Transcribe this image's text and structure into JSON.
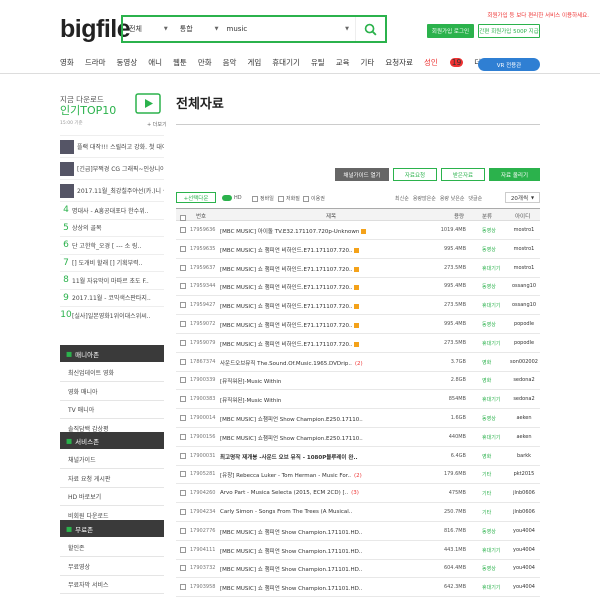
{
  "logo": {
    "text": "bigfile"
  },
  "search": {
    "category": "전체",
    "type": "통합",
    "query": "music"
  },
  "top_right": {
    "note": "회원가입 등 보다 편리한 서비스 이용하세요.",
    "login_label": "회원가입 로그인",
    "promo_label": "간편 회원가입 500P 지급"
  },
  "menu": [
    {
      "label": "영화",
      "hot": false
    },
    {
      "label": "드라마",
      "hot": false
    },
    {
      "label": "동영상",
      "hot": false
    },
    {
      "label": "애니",
      "hot": false
    },
    {
      "label": "웹툰",
      "hot": false
    },
    {
      "label": "만화",
      "hot": false
    },
    {
      "label": "음악",
      "hot": false
    },
    {
      "label": "게임",
      "hot": false
    },
    {
      "label": "휴대기기",
      "hot": false
    },
    {
      "label": "유틸",
      "hot": false
    },
    {
      "label": "교육",
      "hot": false
    },
    {
      "label": "기타",
      "hot": false
    },
    {
      "label": "요청자료",
      "hot": false
    },
    {
      "label": "성인",
      "hot": true
    },
    {
      "label": "더보기",
      "hot": false
    }
  ],
  "menu_badge": "19",
  "vr_label": "VR 전용관",
  "top10": {
    "heading": "지금 다운로드",
    "title": "인기TOP10",
    "sub": "15:00 기준",
    "more": "+ 더보기"
  },
  "ranking": [
    {
      "n": "1",
      "text": "플랙 대작!!! 스릴러고 강화. 첫 대이런~특정 자.."
    },
    {
      "n": "2",
      "text": "[긴급]부쩍경 CG 그래픽~인상니아 계곡의 불 앞 .."
    },
    {
      "n": "3",
      "text": "2017.11월_최강칠주야선(카.)니 셀 D 8트-완벽한글."
    },
    {
      "n": "4",
      "text": "명대사 - A흥공대포다 한수위.."
    },
    {
      "n": "5",
      "text": "상상의 골목"
    },
    {
      "n": "6",
      "text": "단 고한학_오경 [ --- 소 링.."
    },
    {
      "n": "7",
      "text": "[] 도개비 할래 [] 기획부력.."
    },
    {
      "n": "8",
      "text": "11월 자유막이 마따르 초도 F.."
    },
    {
      "n": "9",
      "text": "2017.11월 - 코믹색스판타지.."
    },
    {
      "n": "10",
      "text": "[실사]일본영화1위이대스위씨.."
    }
  ],
  "sections": [
    {
      "title": "매니아존",
      "items": [
        "최신업데이트 영화",
        "영화 매니아",
        "TV 매니아",
        "솔직담백 감상평"
      ]
    },
    {
      "title": "서비스존",
      "items": [
        "채널가이드",
        "자료 요청 게시판",
        "HD 바로보기",
        "비회원 다운로드"
      ]
    },
    {
      "title": "무료존",
      "items": [
        "할인존",
        "무료영상",
        "무료자막 서비스",
        "무료준비"
      ]
    }
  ],
  "main": {
    "title": "전체자료",
    "btn_guide": "채널가이드 열기",
    "btn_request": "자료요청",
    "btn_down": "받은자료",
    "btn_upload": "자료 올리기",
    "filter_label": "+선택다운",
    "opt_hd": "HD",
    "opt_hi": "정바일",
    "opt_low": "저화질",
    "opt_img": "이용권",
    "sorts": [
      "최신순",
      "용량많은순",
      "용량 낮은순",
      "댓글순"
    ],
    "per_page": "20개씩",
    "headers": {
      "no": "번호",
      "title": "제목",
      "size": "용량",
      "cat": "분류",
      "uploader": "아이디"
    }
  },
  "rows": [
    {
      "id": "17959636",
      "title": "[MBC MUSIC] 아이돌 TV.E32.171107.720p-Unknown",
      "bold": false,
      "badge": "",
      "icon": true,
      "size": "1019.4MB",
      "cat": "동영상",
      "up": "mostro1"
    },
    {
      "id": "17959635",
      "title": "[MBC MUSIC] 쇼 챔피언 비하인드.E71.171107.720..",
      "bold": false,
      "badge": "",
      "icon": true,
      "size": "995.4MB",
      "cat": "동영상",
      "up": "mostro1"
    },
    {
      "id": "17959637",
      "title": "[MBC MUSIC] 쇼 챔피언 비하인드.E71.171107.720..",
      "bold": false,
      "badge": "",
      "icon": true,
      "size": "273.5MB",
      "cat": "휴대기기",
      "up": "mostro1"
    },
    {
      "id": "17959344",
      "title": "[MBC MUSIC] 쇼 챔피언 비하인드.E71.171107.720..",
      "bold": false,
      "badge": "",
      "icon": true,
      "size": "995.4MB",
      "cat": "동영상",
      "up": "ossang10"
    },
    {
      "id": "17959427",
      "title": "[MBC MUSIC] 쇼 챔피언 비하인드.E71.171107.720..",
      "bold": false,
      "badge": "",
      "icon": true,
      "size": "273.5MB",
      "cat": "휴대기기",
      "up": "ossang10"
    },
    {
      "id": "17959072",
      "title": "[MBC MUSIC] 쇼 챔피언 비하인드.E71.171107.720..",
      "bold": false,
      "badge": "",
      "icon": true,
      "size": "995.4MB",
      "cat": "동영상",
      "up": "popodle"
    },
    {
      "id": "17959079",
      "title": "[MBC MUSIC] 쇼 챔피언 비하인드.E71.171107.720..",
      "bold": false,
      "badge": "",
      "icon": true,
      "size": "273.5MB",
      "cat": "휴대기기",
      "up": "popodle"
    },
    {
      "id": "17867374",
      "title": "사운드오브뮤직 The.Sound.Of.Music.1965.DVDrip..",
      "bold": false,
      "badge": "(2)",
      "icon": false,
      "size": "3.7GB",
      "cat": "영화",
      "up": "son002002"
    },
    {
      "id": "17900339",
      "title": "[뮤직워된]-Music Within",
      "bold": false,
      "badge": "",
      "icon": false,
      "size": "2.8GB",
      "cat": "영화",
      "up": "sedona2"
    },
    {
      "id": "17900383",
      "title": "[뮤직워된]-Music Within",
      "bold": false,
      "badge": "",
      "icon": false,
      "size": "854MB",
      "cat": "휴대기기",
      "up": "sedona2"
    },
    {
      "id": "17900014",
      "title": "[MBC MUSIC] 쇼챔피언 Show Champion.E250.17110..",
      "bold": false,
      "badge": "",
      "icon": false,
      "size": "1.6GB",
      "cat": "동영상",
      "up": "aeken"
    },
    {
      "id": "17900156",
      "title": "[MBC MUSIC] 쇼챔피언 Show Champion.E250.17110..",
      "bold": false,
      "badge": "",
      "icon": false,
      "size": "440MB",
      "cat": "휴대기기",
      "up": "aeken"
    },
    {
      "id": "17900031",
      "title": "최고명작 재개봉 -사운드 오브 뮤직 - 1080P블루레이 완..",
      "bold": true,
      "badge": "",
      "icon": false,
      "size": "6.4GB",
      "cat": "영화",
      "up": "barkk"
    },
    {
      "id": "17905281",
      "title": "[유창] Rebecca Luker - Tom Herman - Music For..",
      "bold": false,
      "badge": "(2)",
      "icon": false,
      "size": "179.6MB",
      "cat": "기타",
      "up": "pkt2015"
    },
    {
      "id": "17904260",
      "title": "Arvo Part - Musica Selecta (2015, ECM 2CD) [..",
      "bold": false,
      "badge": "(3)",
      "icon": false,
      "size": "475MB",
      "cat": "기타",
      "up": "jlnb0606"
    },
    {
      "id": "17904234",
      "title": "Carly Simon - Songs From The Trees (A Musical..",
      "bold": false,
      "badge": "",
      "icon": false,
      "size": "250.7MB",
      "cat": "기타",
      "up": "jlnb0606"
    },
    {
      "id": "17902776",
      "title": "[MBC MUSIC] 쇼 챔피언 Show Champion.171101.HD..",
      "bold": false,
      "badge": "",
      "icon": false,
      "size": "816.7MB",
      "cat": "동영상",
      "up": "you4004"
    },
    {
      "id": "17904111",
      "title": "[MBC MUSIC] 쇼 챔피언 Show Champion.171101.HD..",
      "bold": false,
      "badge": "",
      "icon": false,
      "size": "443.1MB",
      "cat": "휴대기기",
      "up": "you4004"
    },
    {
      "id": "17903732",
      "title": "[MBC MUSIC] 쇼 챔피언 Show Champion.171101.HD..",
      "bold": false,
      "badge": "",
      "icon": false,
      "size": "604.4MB",
      "cat": "동영상",
      "up": "you4004"
    },
    {
      "id": "17903958",
      "title": "[MBC MUSIC] 쇼 챔피언 Show Champion.171101.HD..",
      "bold": false,
      "badge": "",
      "icon": false,
      "size": "642.3MB",
      "cat": "휴대기기",
      "up": "you4004"
    }
  ]
}
